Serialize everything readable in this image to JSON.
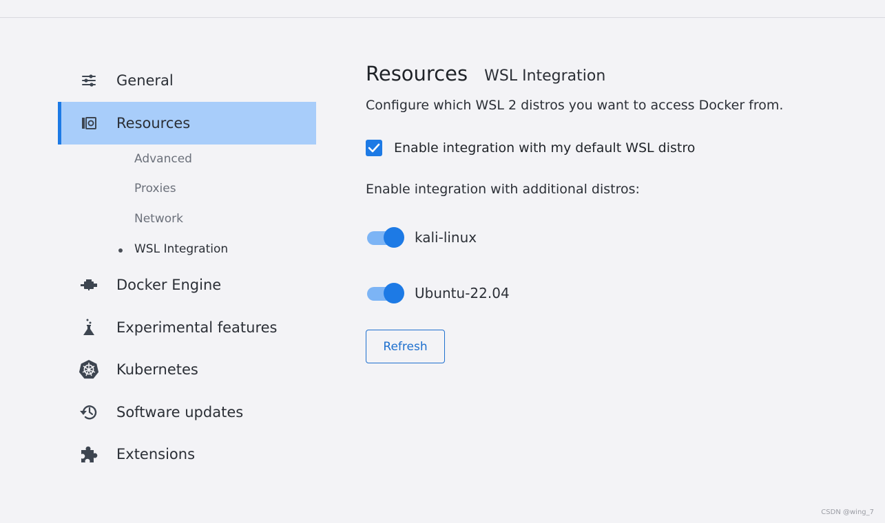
{
  "sidebar": {
    "items": [
      {
        "label": "General",
        "icon": "sliders-icon"
      },
      {
        "label": "Resources",
        "icon": "resources-icon",
        "active": true
      },
      {
        "label": "Docker Engine",
        "icon": "engine-icon"
      },
      {
        "label": "Experimental features",
        "icon": "flask-icon"
      },
      {
        "label": "Kubernetes",
        "icon": "kubernetes-icon"
      },
      {
        "label": "Software updates",
        "icon": "history-icon"
      },
      {
        "label": "Extensions",
        "icon": "puzzle-icon"
      }
    ],
    "resources_subitems": [
      {
        "label": "Advanced"
      },
      {
        "label": "Proxies"
      },
      {
        "label": "Network"
      },
      {
        "label": "WSL Integration",
        "current": true
      }
    ]
  },
  "main": {
    "title": "Resources",
    "subtitle": "WSL Integration",
    "description": "Configure which WSL 2 distros you want to access Docker from.",
    "default_integration": {
      "label": "Enable integration with my default WSL distro",
      "checked": true
    },
    "additional_label": "Enable integration with additional distros:",
    "distros": [
      {
        "name": "kali-linux",
        "enabled": true
      },
      {
        "name": "Ubuntu-22.04",
        "enabled": true
      }
    ],
    "refresh_label": "Refresh"
  },
  "watermark": "CSDN @wing_7",
  "colors": {
    "accent": "#1d7ae5",
    "active_bg": "#a8cdfa",
    "toggle_track": "#7cb4f5",
    "background": "#f3f3f6"
  }
}
